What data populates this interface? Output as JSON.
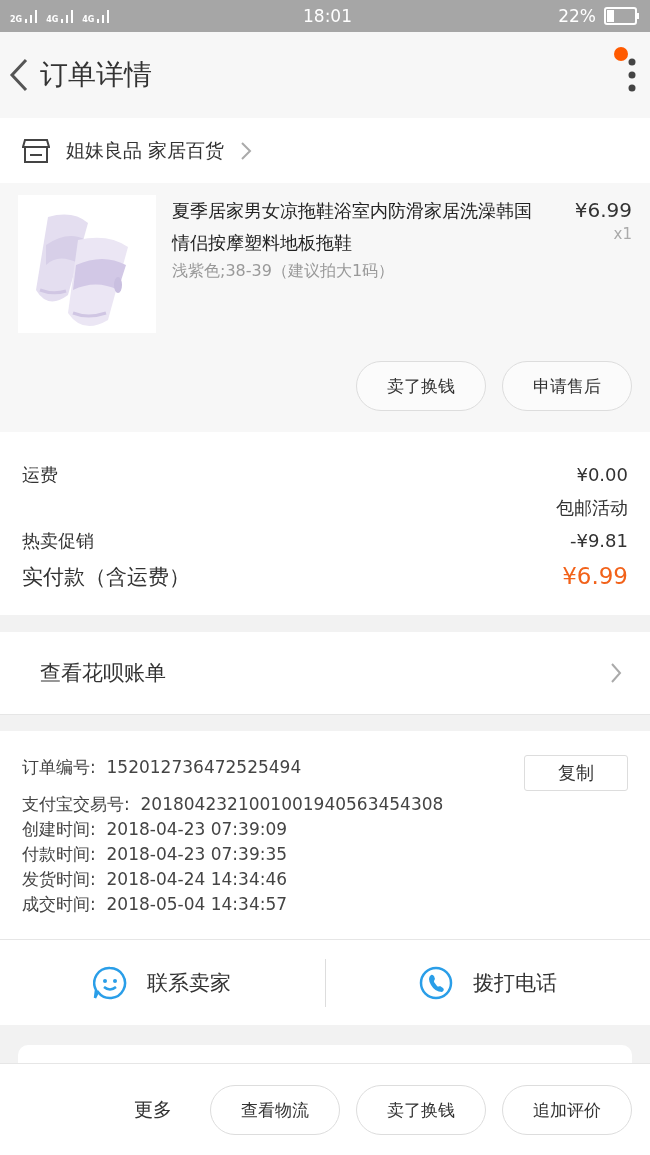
{
  "status_bar": {
    "signal_1": "2G",
    "signal_2": "4G",
    "signal_3": "4G",
    "time": "18:01",
    "battery": "22%"
  },
  "header": {
    "title": "订单详情",
    "notification": true
  },
  "shop": {
    "name": "姐妹良品 家居百货"
  },
  "product": {
    "title": "夏季居家男女凉拖鞋浴室内防滑家居洗澡韩国情侣按摩塑料地板拖鞋",
    "sku": "浅紫色;38-39（建议拍大1码）",
    "price": "¥6.99",
    "quantity": "x1",
    "actions": [
      "卖了换钱",
      "申请售后"
    ]
  },
  "fees": [
    {
      "label": "运费",
      "value": "¥0.00",
      "note": "包邮活动"
    },
    {
      "label": "热卖促销",
      "value": "-¥9.81"
    }
  ],
  "total": {
    "label": "实付款（含运费）",
    "value": "¥6.99"
  },
  "huabei": {
    "label": "查看花呗账单"
  },
  "order_info": {
    "copy_button": "复制",
    "fields": [
      {
        "label": "订单编号:",
        "value": "152012736472525494"
      },
      {
        "label": "支付宝交易号:",
        "value": "2018042321001001940563454308"
      },
      {
        "label": "创建时间:",
        "value": "2018-04-23 07:39:09"
      },
      {
        "label": "付款时间:",
        "value": "2018-04-23 07:39:35"
      },
      {
        "label": "发货时间:",
        "value": "2018-04-24 14:34:46"
      },
      {
        "label": "成交时间:",
        "value": "2018-05-04 14:34:57"
      }
    ]
  },
  "contact": [
    {
      "kind": "chat",
      "label": "联系卖家"
    },
    {
      "kind": "phone",
      "label": "拨打电话"
    }
  ],
  "bottom_bar": {
    "more": "更多",
    "actions": [
      "查看物流",
      "卖了换钱",
      "追加评价"
    ]
  }
}
